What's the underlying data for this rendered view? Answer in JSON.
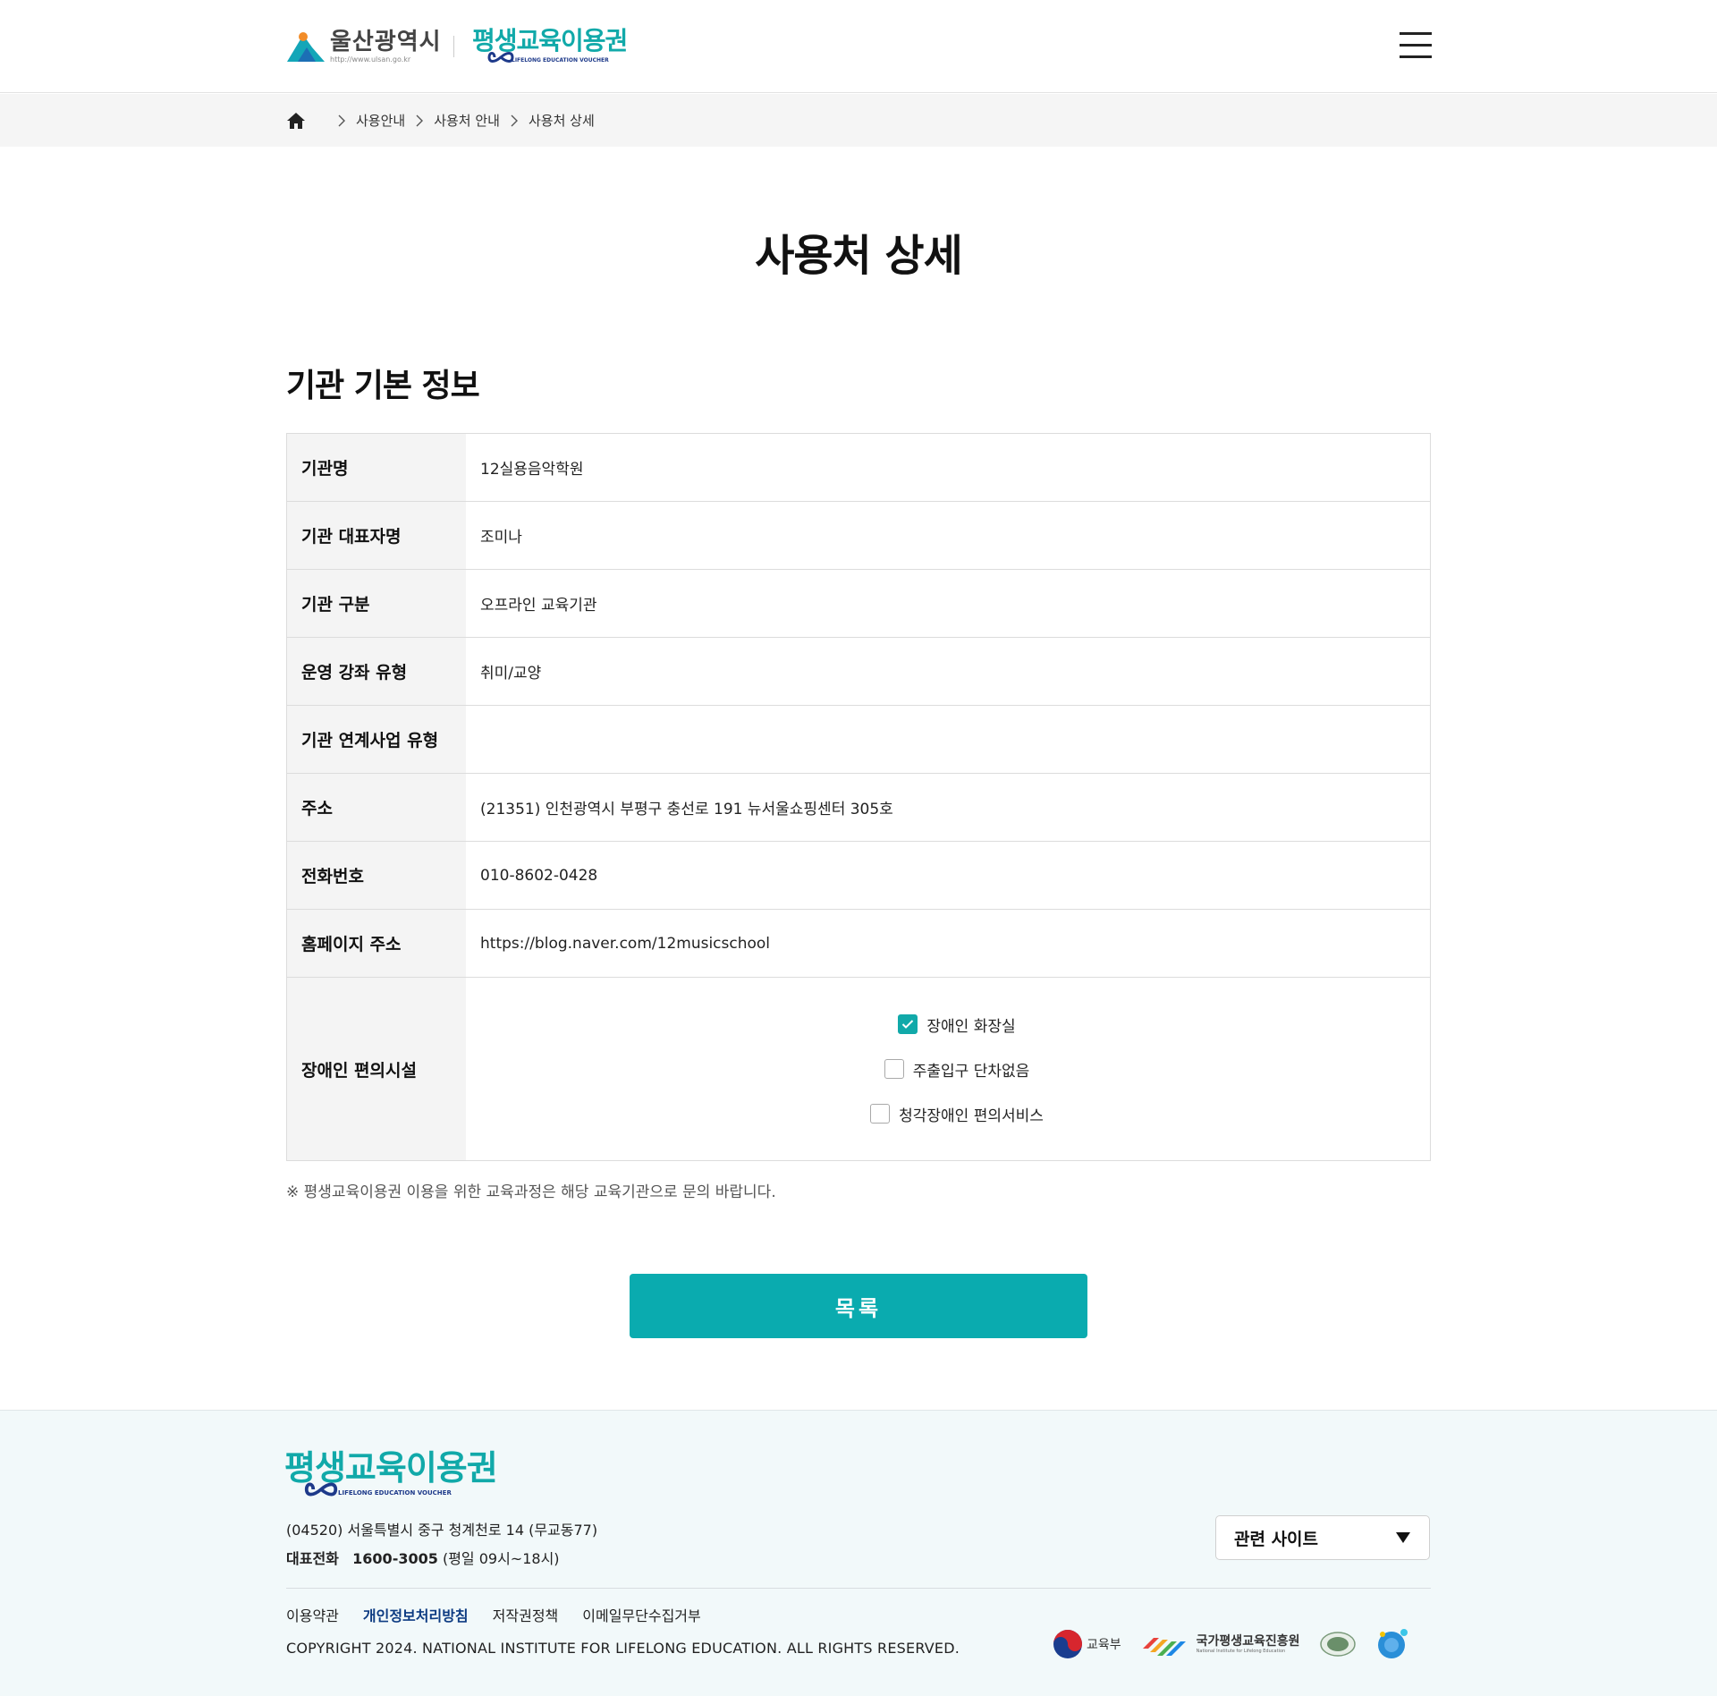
{
  "header": {
    "ulsan_name": "울산광역시",
    "ulsan_url": "http://www.ulsan.go.kr",
    "voucher_name": "평생교육이용권",
    "voucher_sub": "LIFELONG EDUCATION VOUCHER"
  },
  "breadcrumb": [
    "사용안내",
    "사용처 안내",
    "사용처 상세"
  ],
  "page_title": "사용처 상세",
  "section_title": "기관 기본 정보",
  "info": [
    {
      "label": "기관명",
      "value": "12실용음악학원"
    },
    {
      "label": "기관 대표자명",
      "value": "조미나"
    },
    {
      "label": "기관 구분",
      "value": "오프라인 교육기관"
    },
    {
      "label": "운영 강좌 유형",
      "value": "취미/교양"
    },
    {
      "label": "기관 연계사업 유형",
      "value": ""
    },
    {
      "label": "주소",
      "value": "(21351) 인천광역시 부평구 충선로 191 뉴서울쇼핑센터 305호"
    },
    {
      "label": "전화번호",
      "value": "010-8602-0428"
    },
    {
      "label": "홈페이지 주소",
      "value": "https://blog.naver.com/12musicschool"
    }
  ],
  "facilities": {
    "label": "장애인 편의시설",
    "options": [
      {
        "label": "장애인 화장실",
        "checked": true
      },
      {
        "label": "주출입구 단차없음",
        "checked": false
      },
      {
        "label": "청각장애인 편의서비스",
        "checked": false
      }
    ]
  },
  "note": "※  평생교육이용권 이용을 위한 교육과정은 해당 교육기관으로 문의 바랍니다.",
  "list_button": "목록",
  "footer": {
    "logo_name": "평생교육이용권",
    "logo_sub": "LIFELONG EDUCATION VOUCHER",
    "address": "(04520) 서울특별시 중구 청계천로 14 (무교동77)",
    "phone_label": "대표전화",
    "phone": "1600-3005",
    "phone_hours": "(평일 09시~18시)",
    "related_sites": "관련 사이트",
    "links": [
      "이용약관",
      "개인정보처리방침",
      "저작권정책",
      "이메일무단수집거부"
    ],
    "copyright": "COPYRIGHT 2024. NATIONAL INSTITUTE FOR LIFELONG EDUCATION. ALL RIGHTS RESERVED.",
    "partner_moe": "교육부",
    "partner_nile": "국가평생교육진흥원",
    "partner_nile_en": "National Institute for Lifelong Education"
  },
  "colors": {
    "accent": "#0aabaf",
    "brand_navy": "#0d3b82"
  },
  "icons": [
    "hamburger-menu-icon",
    "home-icon",
    "chevron-right-icon",
    "check-icon",
    "triangle-down-icon"
  ]
}
